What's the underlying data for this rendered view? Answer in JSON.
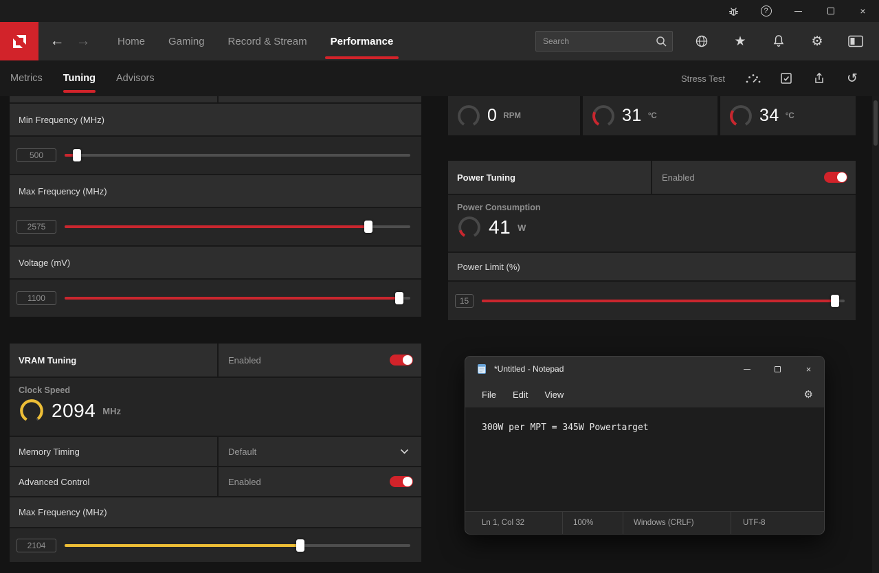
{
  "app": {
    "accent": "#d2232a",
    "slider_red": "#c9262e",
    "slider_yellow": "#edbe36"
  },
  "icons": {
    "back": "←",
    "forward": "→",
    "star": "★",
    "gear": "⚙",
    "reset": "↺",
    "close": "×",
    "help": "?"
  },
  "nav": {
    "items": [
      {
        "label": "Home"
      },
      {
        "label": "Gaming"
      },
      {
        "label": "Record & Stream"
      },
      {
        "label": "Performance"
      }
    ],
    "search": {
      "placeholder": "Search"
    }
  },
  "subnav": {
    "tabs": [
      {
        "label": "Metrics"
      },
      {
        "label": "Tuning"
      },
      {
        "label": "Advisors"
      }
    ],
    "stress_test_label": "Stress Test"
  },
  "gpu": {
    "min_freq": {
      "label": "Min Frequency (MHz)",
      "value": "500",
      "fraction": 0.025,
      "color": "#c9262e"
    },
    "max_freq": {
      "label": "Max Frequency (MHz)",
      "value": "2575",
      "fraction": 0.887,
      "color": "#c9262e"
    },
    "voltage": {
      "label": "Voltage (mV)",
      "value": "1100",
      "fraction": 0.98,
      "color": "#c9262e"
    }
  },
  "vram": {
    "title": "VRAM Tuning",
    "state": "Enabled",
    "clock_speed": {
      "label": "Clock Speed",
      "value": "2094",
      "unit": "MHz",
      "fraction": 0.97,
      "color": "#edbe36"
    },
    "memory_timing": {
      "label": "Memory Timing",
      "value": "Default"
    },
    "advanced_control": {
      "label": "Advanced Control",
      "value": "Enabled"
    },
    "max_freq": {
      "label": "Max Frequency (MHz)",
      "value": "2104",
      "fraction": 0.687,
      "color": "#edbe36"
    }
  },
  "metrics": {
    "fan": {
      "value": "0",
      "unit": "RPM",
      "fraction": 0,
      "color": "#c9262e"
    },
    "temp_a": {
      "value": "31",
      "unit": "°C",
      "fraction": 0.28,
      "color": "#c9262e"
    },
    "temp_b": {
      "value": "34",
      "unit": "°C",
      "fraction": 0.31,
      "color": "#c9262e"
    }
  },
  "power": {
    "title": "Power Tuning",
    "state": "Enabled",
    "consumption": {
      "label": "Power Consumption",
      "value": "41",
      "unit": "W",
      "fraction": 0.14,
      "color": "#c9262e"
    },
    "limit": {
      "label": "Power Limit (%)",
      "value": "15",
      "fraction": 0.985,
      "color": "#c9262e"
    }
  },
  "notepad": {
    "title": "*Untitled - Notepad",
    "menus": [
      "File",
      "Edit",
      "View"
    ],
    "content": "300W per MPT = 345W Powertarget",
    "status": {
      "position": "Ln 1, Col 32",
      "zoom": "100%",
      "line_ending": "Windows (CRLF)",
      "encoding": "UTF-8"
    }
  }
}
